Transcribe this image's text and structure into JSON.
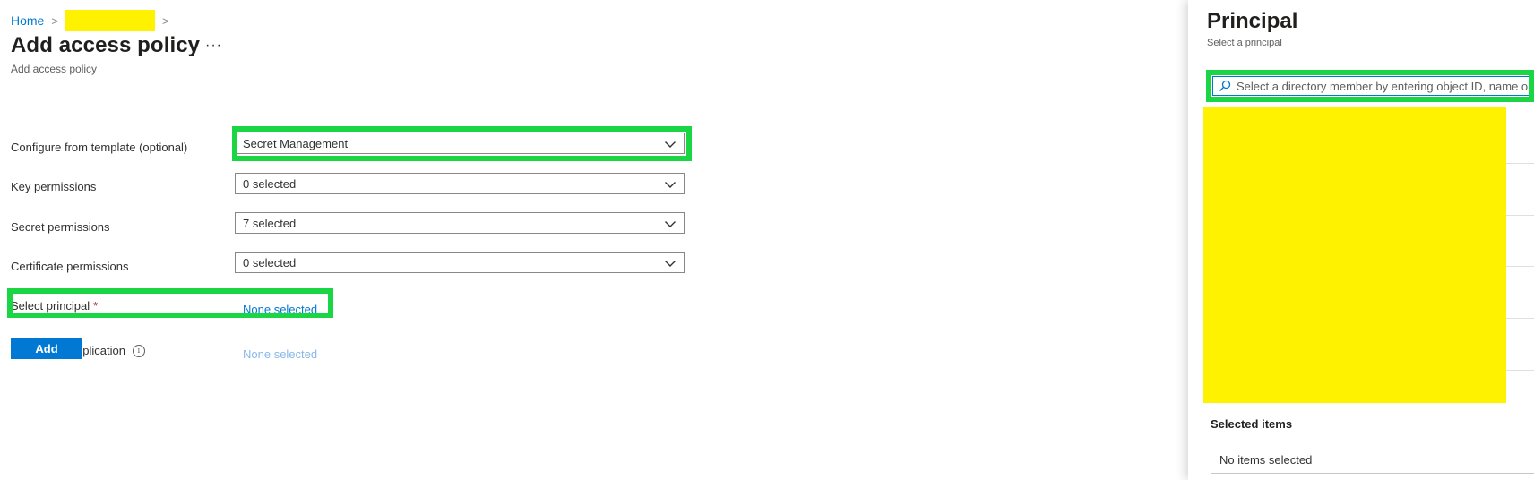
{
  "breadcrumb": {
    "home": "Home"
  },
  "page": {
    "title": "Add access policy",
    "more_label": "···",
    "subtitle": "Add access policy"
  },
  "form": {
    "template": {
      "label": "Configure from template (optional)",
      "value": "Secret Management"
    },
    "key_permissions": {
      "label": "Key permissions",
      "value": "0 selected"
    },
    "secret_permissions": {
      "label": "Secret permissions",
      "value": "7 selected"
    },
    "certificate_permissions": {
      "label": "Certificate permissions",
      "value": "0 selected"
    },
    "principal": {
      "label": "Select principal",
      "required_mark": "*",
      "value": "None selected"
    },
    "authorized_application": {
      "label": "Authorized application",
      "info": "i",
      "value": "None selected"
    },
    "add_label": "Add"
  },
  "blade": {
    "title": "Principal",
    "subtitle": "Select a principal",
    "search_placeholder": "Select a directory member by entering object ID, name or",
    "selected_items_title": "Selected items",
    "selected_items_empty": "No items selected"
  },
  "colors": {
    "accent": "#0078d4",
    "highlight": "#1bd644",
    "redaction": "#fff200",
    "required": "#a4262c"
  },
  "icons": {
    "more": "more-icon",
    "chevron": "chevron-down-icon",
    "info": "info-icon",
    "search": "search-icon"
  }
}
